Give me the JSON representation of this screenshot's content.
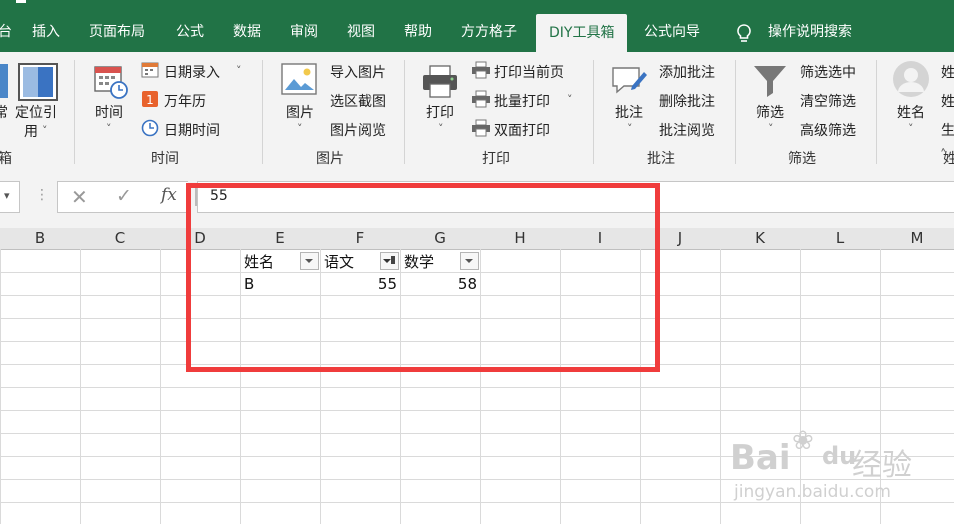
{
  "tabs": [
    "台",
    "插入",
    "页面布局",
    "公式",
    "数据",
    "审阅",
    "视图",
    "帮助",
    "方方格子",
    "DIY工具箱",
    "公式向导",
    "操作说明搜索"
  ],
  "active_tab": "DIY工具箱",
  "ribbon": {
    "left_partial": {
      "label1": "常",
      "label2a": "定位引",
      "label2b": "用",
      "group": "箱"
    },
    "time": {
      "group": "时间",
      "big": "时间",
      "items": [
        "日期录入",
        "万年历",
        "日期时间"
      ]
    },
    "picture": {
      "group": "图片",
      "big": "图片",
      "items": [
        "导入图片",
        "选区截图",
        "图片阅览"
      ]
    },
    "print": {
      "group": "打印",
      "big": "打印",
      "items": [
        "打印当前页",
        "批量打印",
        "双面打印"
      ]
    },
    "comment": {
      "group": "批注",
      "big": "批注",
      "items": [
        "添加批注",
        "删除批注",
        "批注阅览"
      ]
    },
    "filter": {
      "group": "筛选",
      "big": "筛选",
      "items": [
        "筛选选中",
        "清空筛选",
        "高级筛选"
      ]
    },
    "name": {
      "group": "姓",
      "big": "姓名",
      "items": [
        "姓",
        "姓",
        "生"
      ]
    }
  },
  "formula_bar": {
    "value": "55"
  },
  "columns": [
    "B",
    "C",
    "D",
    "E",
    "F",
    "G",
    "H",
    "I",
    "J",
    "K",
    "L",
    "M"
  ],
  "table": {
    "headers": [
      "姓名",
      "语文",
      "数学"
    ],
    "row": [
      "B",
      "55",
      "58"
    ]
  },
  "watermark": {
    "brand": "Bai",
    "du": "du",
    "jy": "经验",
    "url": "jingyan.baidu.com"
  },
  "colors": {
    "ribbon_green": "#217346",
    "highlight_red": "#f03c3c"
  }
}
